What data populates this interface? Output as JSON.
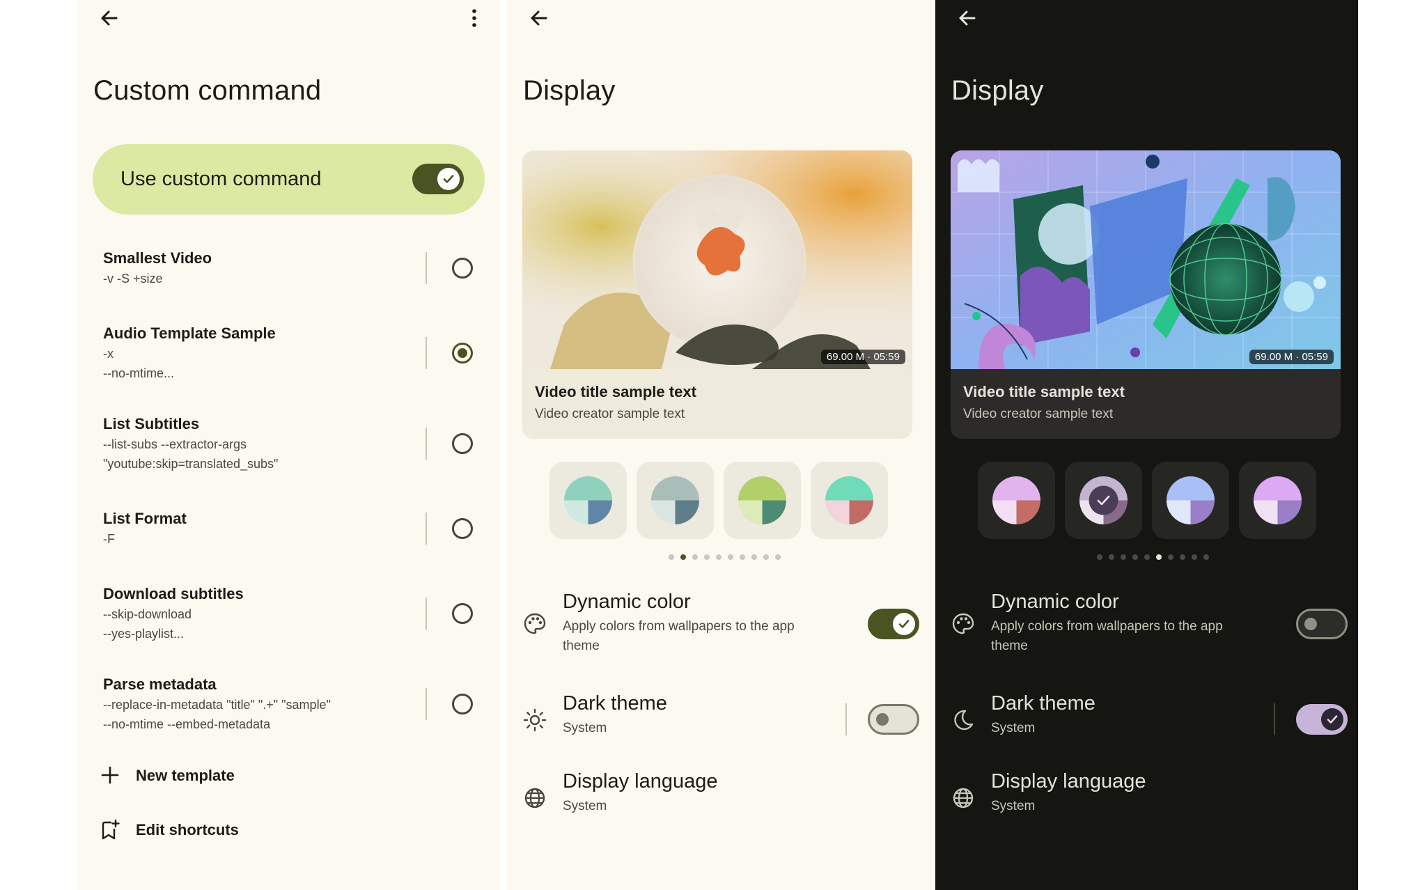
{
  "colors": {
    "accent_light": "#4a5422",
    "card_light": "#dce9a2",
    "accent_dark": "#c8b3d8",
    "bg_light": "#fcf9f1",
    "bg_dark": "#151512"
  },
  "custom_command": {
    "title": "Custom command",
    "back_icon": "arrow-back-icon",
    "overflow_icon": "more-vert-icon",
    "use_custom": {
      "label": "Use custom command",
      "enabled": true
    },
    "templates": [
      {
        "title": "Smallest Video",
        "args": [
          "-v -S +size"
        ],
        "selected": false
      },
      {
        "title": "Audio Template Sample",
        "args": [
          "-x",
          "--no-mtime..."
        ],
        "selected": true
      },
      {
        "title": "List Subtitles",
        "args": [
          "--list-subs --extractor-args",
          "\"youtube:skip=translated_subs\""
        ],
        "selected": false
      },
      {
        "title": "List Format",
        "args": [
          "-F"
        ],
        "selected": false
      },
      {
        "title": "Download subtitles",
        "args": [
          "--skip-download",
          "--yes-playlist..."
        ],
        "selected": false
      },
      {
        "title": "Parse metadata",
        "args": [
          "--replace-in-metadata \"title\" \".+\" \"sample\"",
          "--no-mtime --embed-metadata"
        ],
        "selected": false
      }
    ],
    "actions": [
      {
        "label": "New template",
        "icon": "plus-icon"
      },
      {
        "label": "Edit shortcuts",
        "icon": "bookmark-add-icon"
      }
    ]
  },
  "display_light": {
    "title": "Display",
    "video": {
      "badge": "69.00 M · 05:59",
      "title": "Video title sample text",
      "creator": "Video creator sample text"
    },
    "selected_swatch": 1,
    "page_dots": {
      "count": 10,
      "active": 1
    },
    "settings": {
      "dynamic_color": {
        "title": "Dynamic color",
        "subtitle": "Apply colors from wallpapers to the app theme",
        "enabled": true,
        "icon": "palette-icon"
      },
      "dark_theme": {
        "title": "Dark theme",
        "subtitle": "System",
        "enabled": false,
        "icon": "sun-icon"
      },
      "language": {
        "title": "Display language",
        "subtitle": "System",
        "icon": "globe-icon"
      }
    }
  },
  "display_dark": {
    "title": "Display",
    "video": {
      "badge": "69.00 M · 05:59",
      "title": "Video title sample text",
      "creator": "Video creator sample text"
    },
    "selected_swatch": 1,
    "page_dots": {
      "count": 10,
      "active": 5
    },
    "settings": {
      "dynamic_color": {
        "title": "Dynamic color",
        "subtitle": "Apply colors from wallpapers to the app theme",
        "enabled": false,
        "icon": "palette-icon"
      },
      "dark_theme": {
        "title": "Dark theme",
        "subtitle": "System",
        "enabled": true,
        "icon": "moon-icon"
      },
      "language": {
        "title": "Display language",
        "subtitle": "System",
        "icon": "globe-icon"
      }
    }
  }
}
